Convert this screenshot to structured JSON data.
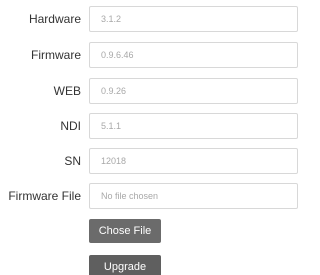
{
  "device_info": {
    "rows": [
      {
        "label": "Hardware",
        "value": "3.1.2"
      },
      {
        "label": "Firmware",
        "value": "0.9.6.46"
      },
      {
        "label": "WEB",
        "value": "0.9.26"
      },
      {
        "label": "NDI",
        "value": "5.1.1"
      },
      {
        "label": "SN",
        "value": "12018"
      }
    ]
  },
  "firmware_upload": {
    "label": "Firmware File",
    "file_status": "No file chosen",
    "chose_file_label": "Chose File",
    "upgrade_label": "Upgrade"
  },
  "colors": {
    "button_bg": "#6b6b6b",
    "button_text": "#ffffff",
    "field_border": "#d8d8d8",
    "value_text": "#a8a8a8",
    "label_text": "#333333"
  }
}
